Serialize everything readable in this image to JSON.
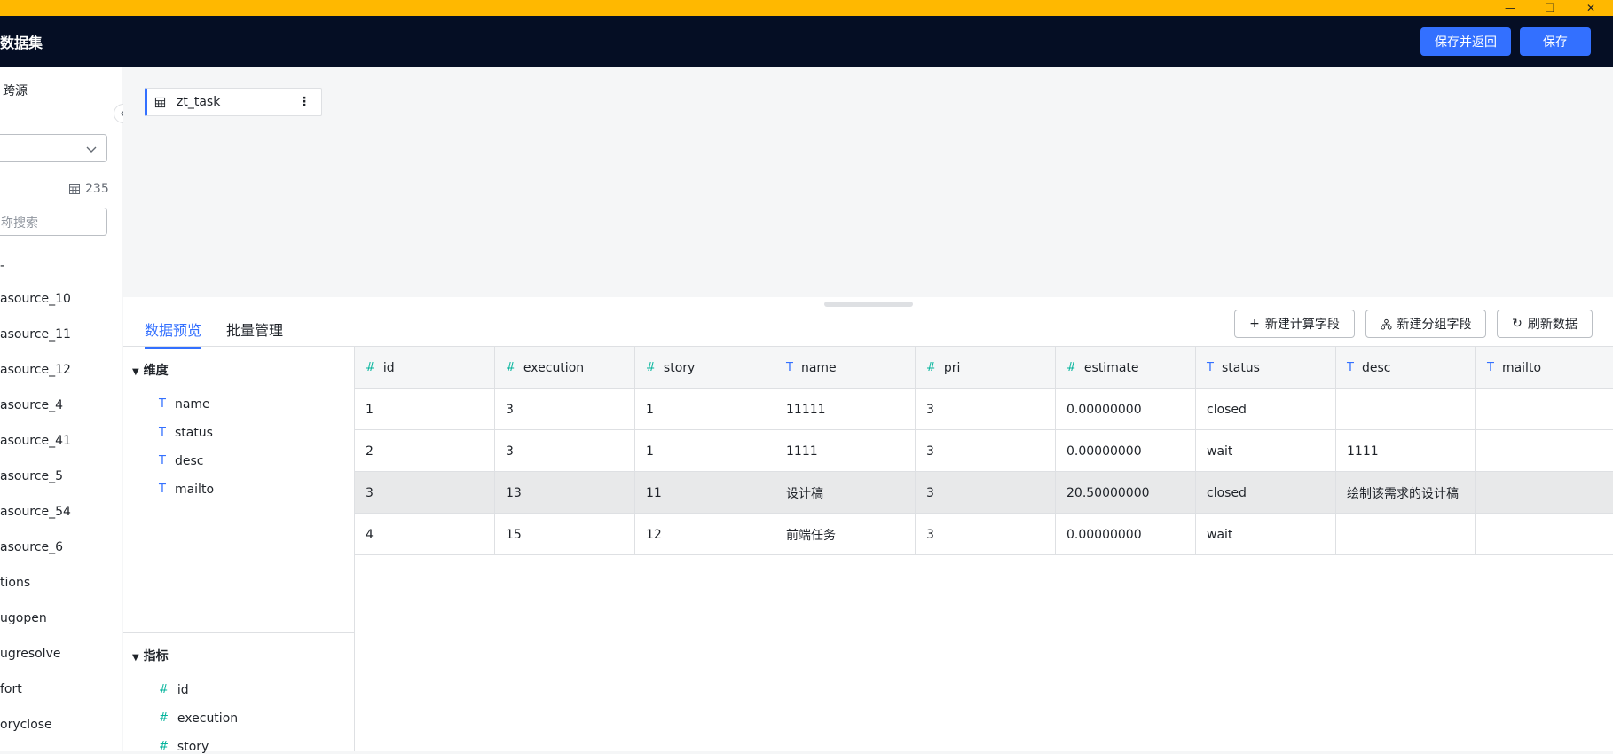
{
  "header": {
    "title": "数据集",
    "save_return_label": "保存并返回",
    "save_label": "保存"
  },
  "left_panel": {
    "mode_label": "跨源",
    "table_count": "235",
    "search_placeholder": "称搜索",
    "dash": "-",
    "tables": [
      "asource_10",
      "asource_11",
      "asource_12",
      "asource_4",
      "asource_41",
      "asource_5",
      "asource_54",
      "asource_6",
      "tions",
      "ugopen",
      "ugresolve",
      "fort",
      "oryclose"
    ]
  },
  "canvas": {
    "table_name": "zt_task"
  },
  "bottom": {
    "tabs": [
      "数据预览",
      "批量管理"
    ],
    "actions": {
      "new_calc_field": "新建计算字段",
      "new_group_field": "新建分组字段",
      "refresh_data": "刷新数据"
    },
    "dimension_label": "维度",
    "dimensions": [
      "name",
      "status",
      "desc",
      "mailto"
    ],
    "metric_label": "指标",
    "metrics": [
      "id",
      "execution",
      "story"
    ]
  },
  "grid": {
    "columns": [
      {
        "name": "id",
        "type": "number"
      },
      {
        "name": "execution",
        "type": "number"
      },
      {
        "name": "story",
        "type": "number"
      },
      {
        "name": "name",
        "type": "text"
      },
      {
        "name": "pri",
        "type": "number"
      },
      {
        "name": "estimate",
        "type": "number"
      },
      {
        "name": "status",
        "type": "text"
      },
      {
        "name": "desc",
        "type": "text"
      },
      {
        "name": "mailto",
        "type": "text"
      }
    ],
    "rows": [
      [
        "1",
        "3",
        "1",
        "11111",
        "3",
        "0.00000000",
        "closed",
        "",
        ""
      ],
      [
        "2",
        "3",
        "1",
        "1111",
        "3",
        "0.00000000",
        "wait",
        "1111",
        ""
      ],
      [
        "3",
        "13",
        "11",
        "设计稿",
        "3",
        "20.50000000",
        "closed",
        "绘制该需求的设计稿",
        ""
      ],
      [
        "4",
        "15",
        "12",
        "前端任务",
        "3",
        "0.00000000",
        "wait",
        "",
        ""
      ]
    ],
    "highlight_row": 2
  },
  "colors": {
    "accent": "#3370ff",
    "titlebar": "#ffb800",
    "header_bg": "#050e24",
    "number_icon": "#04b49c"
  }
}
